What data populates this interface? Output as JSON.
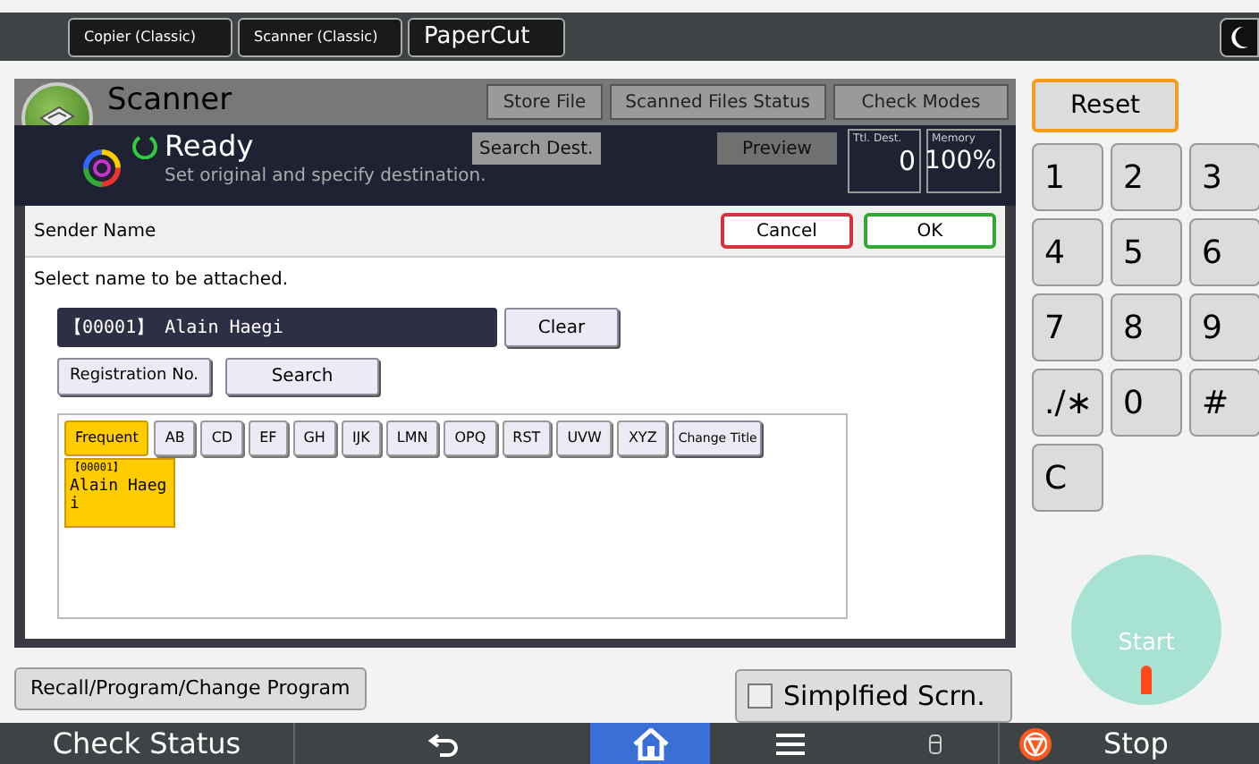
{
  "top_tabs": [
    {
      "label": "Copier (Classic)"
    },
    {
      "label": "Scanner (Classic)"
    },
    {
      "label": "PaperCut"
    }
  ],
  "scanner": {
    "title": "Scanner",
    "buttons": [
      "Store File",
      "Scanned Files Status",
      "Check Modes"
    ],
    "status": "Ready",
    "message": "Set original and specify destination.",
    "search_dest": "Search Dest.",
    "preview": "Preview",
    "ttl_dest_label": "Ttl. Dest.",
    "ttl_dest_value": "0",
    "memory_label": "Memory",
    "memory_value": "100%"
  },
  "dialog": {
    "title": "Sender Name",
    "cancel": "Cancel",
    "ok": "OK",
    "instruction": "Select name to be attached.",
    "selected_name": "【00001】 Alain Haegi",
    "clear": "Clear",
    "registration": "Registration No.",
    "search": "Search",
    "tabs": [
      {
        "label": "Frequent",
        "selected": true
      },
      {
        "label": "AB",
        "selected": false
      },
      {
        "label": "CD",
        "selected": false
      },
      {
        "label": "EF",
        "selected": false
      },
      {
        "label": "GH",
        "selected": false
      },
      {
        "label": "IJK",
        "selected": false
      },
      {
        "label": "LMN",
        "selected": false
      },
      {
        "label": "OPQ",
        "selected": false
      },
      {
        "label": "RST",
        "selected": false
      },
      {
        "label": "UVW",
        "selected": false
      },
      {
        "label": "XYZ",
        "selected": false
      }
    ],
    "change_title": "Change Title",
    "entries": [
      {
        "number": "【00001】",
        "name": "Alain Haegi",
        "selected": true
      }
    ]
  },
  "reset": "Reset",
  "keypad": [
    "1",
    "2",
    "3",
    "4",
    "5",
    "6",
    "7",
    "8",
    "9",
    "./∗",
    "0",
    "#",
    "C"
  ],
  "start": "Start",
  "recall": "Recall/Program/Change Program",
  "simplified": {
    "label": "Simplfied Scrn.",
    "checked": false
  },
  "bottom": {
    "check_status": "Check Status",
    "stop": "Stop"
  }
}
